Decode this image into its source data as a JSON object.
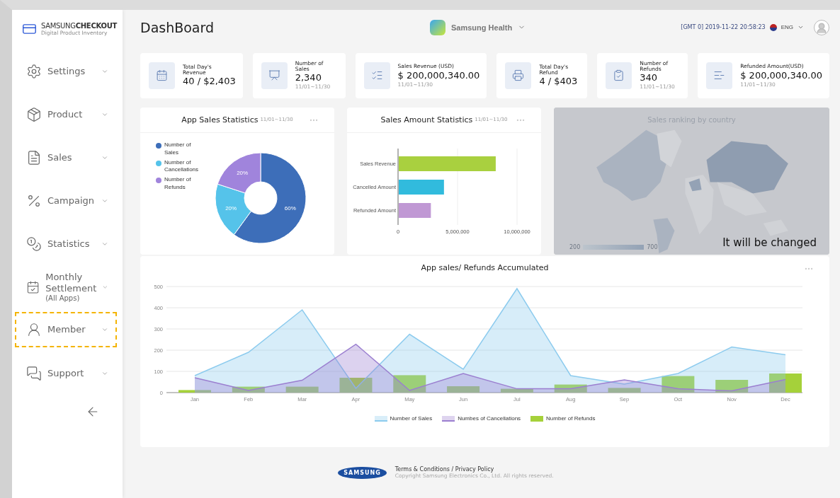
{
  "brand": {
    "name_light": "SAMSUNG",
    "name_bold": "CHECKOUT",
    "subtitle": "Digital Product Inventory"
  },
  "sidebar": {
    "items": [
      {
        "kind": "settings",
        "label": "Settings",
        "highlighted": false
      },
      {
        "kind": "product",
        "label": "Product",
        "highlighted": false
      },
      {
        "kind": "sales",
        "label": "Sales",
        "highlighted": false
      },
      {
        "kind": "campaign",
        "label": "Campaign",
        "highlighted": false
      },
      {
        "kind": "statistics",
        "label": "Statistics",
        "highlighted": false
      },
      {
        "kind": "settlement",
        "label": "Monthly Settlement",
        "note": "(All Apps)",
        "highlighted": false
      },
      {
        "kind": "member",
        "label": "Member",
        "highlighted": true
      },
      {
        "kind": "support",
        "label": "Support",
        "highlighted": false
      }
    ]
  },
  "header": {
    "title": "DashBoard",
    "app": "Samsung Health",
    "timestamp": "[GMT 0] 2019-11-22 20:58:23",
    "language": "ENG"
  },
  "stats": [
    {
      "kind": "calendar",
      "label": "Total Day's Revenue",
      "value": "40 / $2,403"
    },
    {
      "kind": "presentation",
      "label": "Number of Sales",
      "value": "2,340",
      "period": "11/01~11/30"
    },
    {
      "kind": "check",
      "label": "Sales Revenue (USD)",
      "value": "$ 200,000,340.00",
      "period": "11/01~11/30"
    },
    {
      "kind": "printer",
      "label": "Total Day's Refund",
      "value": "4 / $403"
    },
    {
      "kind": "clipboard",
      "label": "Number of Refunds",
      "value": "340",
      "period": "11/01~11/30"
    },
    {
      "kind": "minus",
      "label": "Refunded Amount(USD)",
      "value": "$ 200,000,340.00",
      "period": "11/01~11/30"
    }
  ],
  "app_sales": {
    "title": "App Sales Statistics",
    "period": "11/01~11/30",
    "legend": [
      {
        "color": "#3d6eb9"
      },
      {
        "color": "#55c3ea"
      },
      {
        "color": "#a084dc"
      }
    ],
    "chart_data": {
      "type": "donut",
      "categories": [
        "Number of Sales",
        "Number of Cancellations",
        "Number of Refunds"
      ],
      "values": [
        60,
        20,
        20
      ],
      "value_labels": [
        "60%",
        "20%",
        "20%"
      ]
    }
  },
  "sales_amount": {
    "title": "Sales Amount Statistics",
    "period": "11/01~11/30",
    "chart_data": {
      "type": "bar",
      "orientation": "horizontal",
      "xlim": [
        0,
        10000000
      ],
      "xticks": [
        {
          "value": 0,
          "label": "0"
        },
        {
          "value": 5000000,
          "label": "5,000,000"
        },
        {
          "value": 10000000,
          "label": "10,000,000"
        }
      ],
      "series": [
        {
          "name": "Sales Revenue",
          "color": "#a9d03f",
          "values": [
            8150000,
            null,
            null
          ]
        },
        {
          "name": "Cancelled Amount",
          "color": "#31bbdd",
          "values": [
            null,
            3800000,
            null
          ]
        },
        {
          "name": "Refunded Amount",
          "color": "#c098d4",
          "values": [
            null,
            null,
            2700000
          ]
        }
      ]
    }
  },
  "country": {
    "title": "Sales ranking by country",
    "range_min": "200",
    "range_max": "700",
    "note": "It will be changed",
    "kind": "picture"
  },
  "accumulated": {
    "title": "App sales/ Refunds Accumulated",
    "chart_data": {
      "type": "line",
      "categories": [
        "Jan",
        "Feb",
        "Mar",
        "Apr",
        "May",
        "Jun",
        "Jul",
        "Aug",
        "Sep",
        "Oct",
        "Nov",
        "Dec"
      ],
      "ylim": [
        0,
        500
      ],
      "grid": true,
      "yticks": [
        0,
        100,
        200,
        300,
        400,
        500
      ],
      "series": [
        {
          "name": "Number of Sales",
          "type": "area",
          "color": "#8ccbee",
          "values": [
            80,
            190,
            390,
            20,
            275,
            110,
            490,
            80,
            40,
            90,
            215,
            178
          ]
        },
        {
          "name": "Numbes of Cancellations",
          "type": "area",
          "color": "#9b7fd0",
          "values": [
            70,
            10,
            58,
            228,
            10,
            90,
            18,
            18,
            60,
            18,
            8,
            62
          ]
        },
        {
          "name": "Number of Refunds",
          "type": "bar",
          "color": "#a5d13a",
          "values": [
            12,
            28,
            28,
            70,
            82,
            30,
            18,
            38,
            22,
            78,
            60,
            90
          ]
        }
      ]
    }
  },
  "footer": {
    "logo": "SAMSUNG",
    "links": "Terms & Conditions / Privacy Policy",
    "copyright": "Copyright Samsung Electronics Co., Ltd. All rights reserved."
  }
}
